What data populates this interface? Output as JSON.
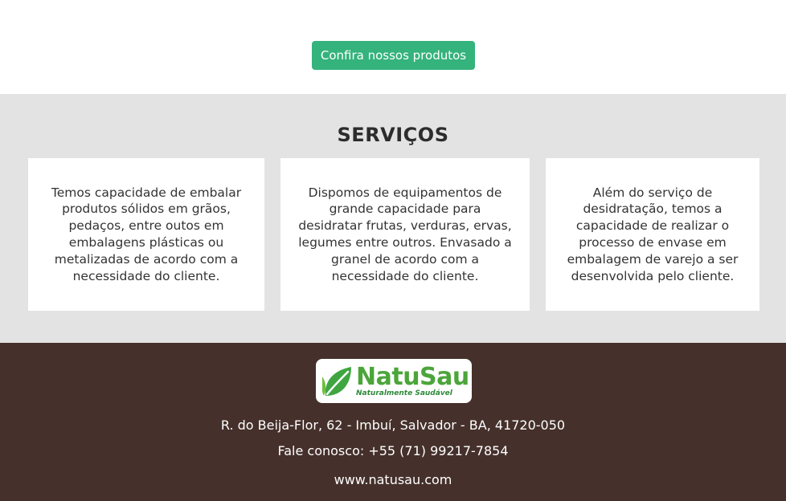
{
  "cta": {
    "label": "Confira nossos produtos"
  },
  "services": {
    "title": "SERVIÇOS",
    "cards": [
      {
        "text": "Temos capacidade de embalar produtos sólidos em grãos, pedaços, entre outos em embalagens plásticas ou metalizadas de acordo com a necessidade do cliente."
      },
      {
        "text": "Dispomos de equipamentos de grande capacidade para desidratar frutas, verduras, ervas, legumes entre outros. Envasado a granel de acordo com a necessidade do cliente."
      },
      {
        "text": "Além do serviço de desidratação, temos a capacidade de realizar o processo de envase em embalagem de varejo a ser desenvolvida pelo cliente."
      }
    ]
  },
  "footer": {
    "logo": {
      "name": "NatuSau",
      "tagline": "Naturalmente Saudável",
      "icon": "leaf-icon"
    },
    "address": "R. do Beija-Flor, 62 - Imbuí, Salvador - BA, 41720-050",
    "phone": "Fale conosco: +55 (71) 99217-7854",
    "website": "www.natusau.com"
  },
  "colors": {
    "accent": "#34b37c",
    "section_bg": "#e3e3e3",
    "footer_bg": "#45302b",
    "logo_green": "#4ca53a"
  }
}
